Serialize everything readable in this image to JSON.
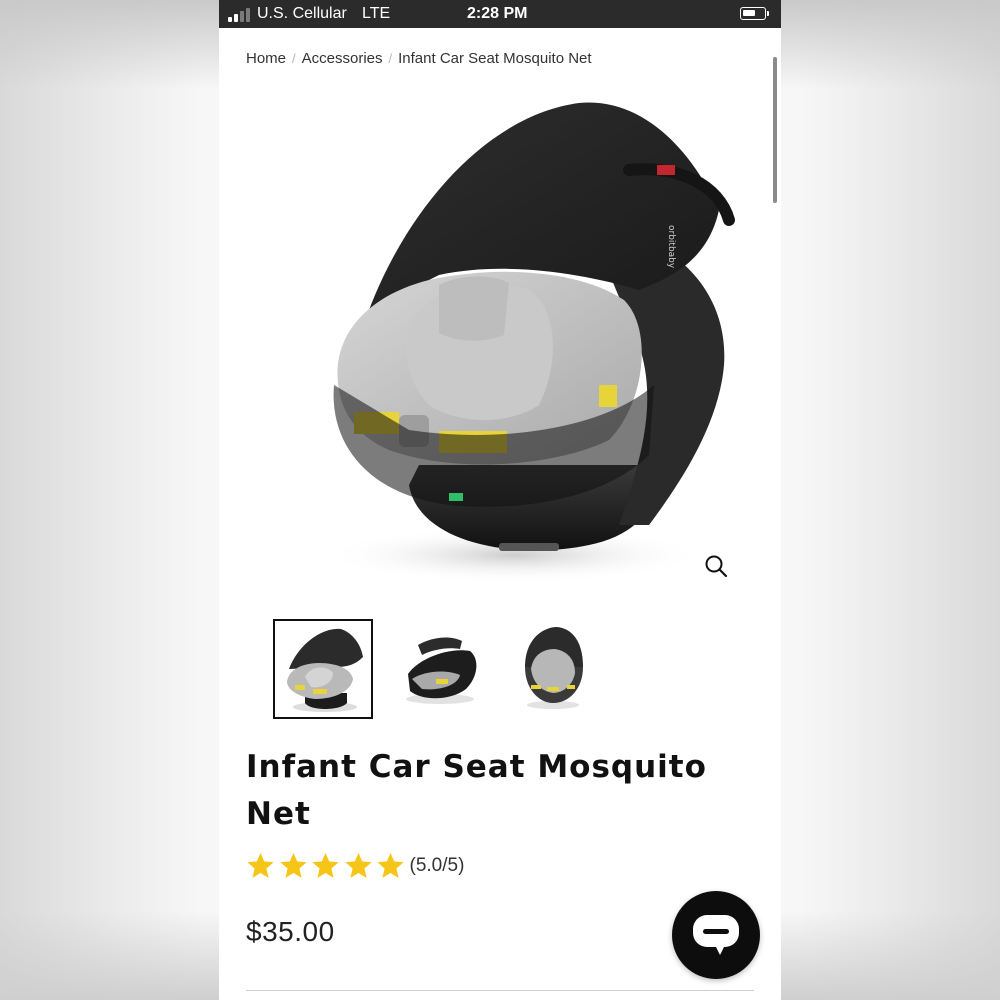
{
  "status_bar": {
    "carrier": "U.S. Cellular",
    "network": "LTE",
    "time": "2:28 PM",
    "signal_bars_filled": 2,
    "signal_bars_total": 4,
    "battery_level": 0.65
  },
  "breadcrumb": {
    "items": [
      "Home",
      "Accessories",
      "Infant Car Seat Mosquito Net"
    ],
    "separator": "/"
  },
  "product": {
    "title": "Infant Car Seat Mosquito Net",
    "rating_value": 5.0,
    "rating_max": 5,
    "rating_text": "(5.0/5)",
    "price": "$35.00",
    "image_brand_text": "orbitbaby"
  },
  "gallery": {
    "thumbnails": [
      "car-seat-front-three-quarter-thumbnail",
      "car-seat-side-thumbnail",
      "car-seat-front-thumbnail"
    ],
    "active_index": 0
  },
  "icons": {
    "zoom": "magnifier-icon",
    "chat": "chat-bubble-icon"
  },
  "colors": {
    "status_bar": "#2b2b2b",
    "star": "#f5c518",
    "chat_button": "#0d0d0d"
  }
}
